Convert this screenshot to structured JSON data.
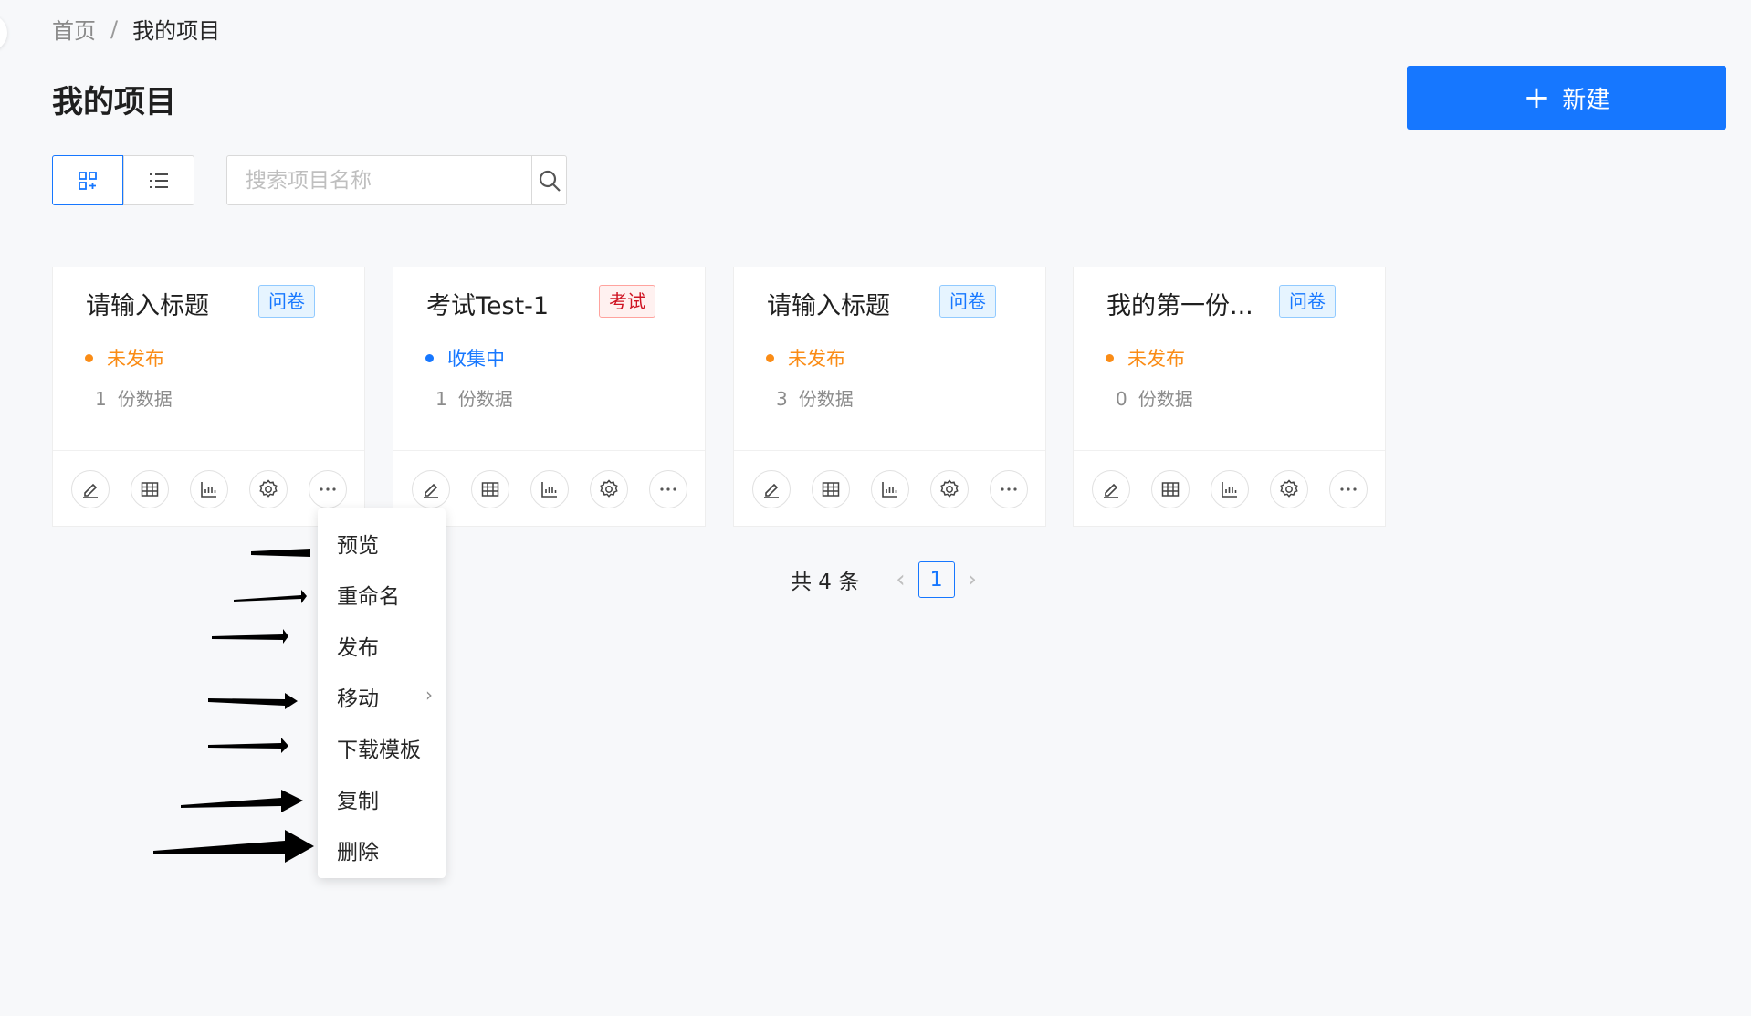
{
  "breadcrumb": {
    "home": "首页",
    "separator": "/",
    "current": "我的项目"
  },
  "page": {
    "title": "我的项目"
  },
  "toolbar": {
    "new_label": "新建",
    "new_icon": "plus-icon"
  },
  "view_toggle": {
    "active": "grid",
    "grid_icon": "grid-icon",
    "list_icon": "list-icon"
  },
  "search": {
    "placeholder": "搜索项目名称",
    "value": "",
    "icon": "search-icon"
  },
  "projects": [
    {
      "title": "请输入标题",
      "tag": "问卷",
      "tag_color": "#1677ff",
      "status": "未发布",
      "status_color": "#fa8c16",
      "count": "1",
      "count_label": "份数据"
    },
    {
      "title": "考试Test-1",
      "tag": "考试",
      "tag_color": "#cf1322",
      "status": "收集中",
      "status_color": "#1677ff",
      "count": "1",
      "count_label": "份数据"
    },
    {
      "title": "请输入标题",
      "tag": "问卷",
      "tag_color": "#1677ff",
      "status": "未发布",
      "status_color": "#fa8c16",
      "count": "3",
      "count_label": "份数据"
    },
    {
      "title": "我的第一份...",
      "tag": "问卷",
      "tag_color": "#1677ff",
      "status": "未发布",
      "status_color": "#fa8c16",
      "count": "0",
      "count_label": "份数据"
    }
  ],
  "card_actions": [
    "edit-icon",
    "table-icon",
    "chart-icon",
    "settings-icon",
    "more-icon"
  ],
  "pagination": {
    "total_text": "共 4 条",
    "current_page": "1",
    "prev": "‹",
    "next": "›"
  },
  "context_menu": {
    "items": [
      "预览",
      "重命名",
      "发布",
      "移动",
      "下载模板",
      "复制",
      "删除"
    ],
    "submenu_arrow": "›"
  }
}
